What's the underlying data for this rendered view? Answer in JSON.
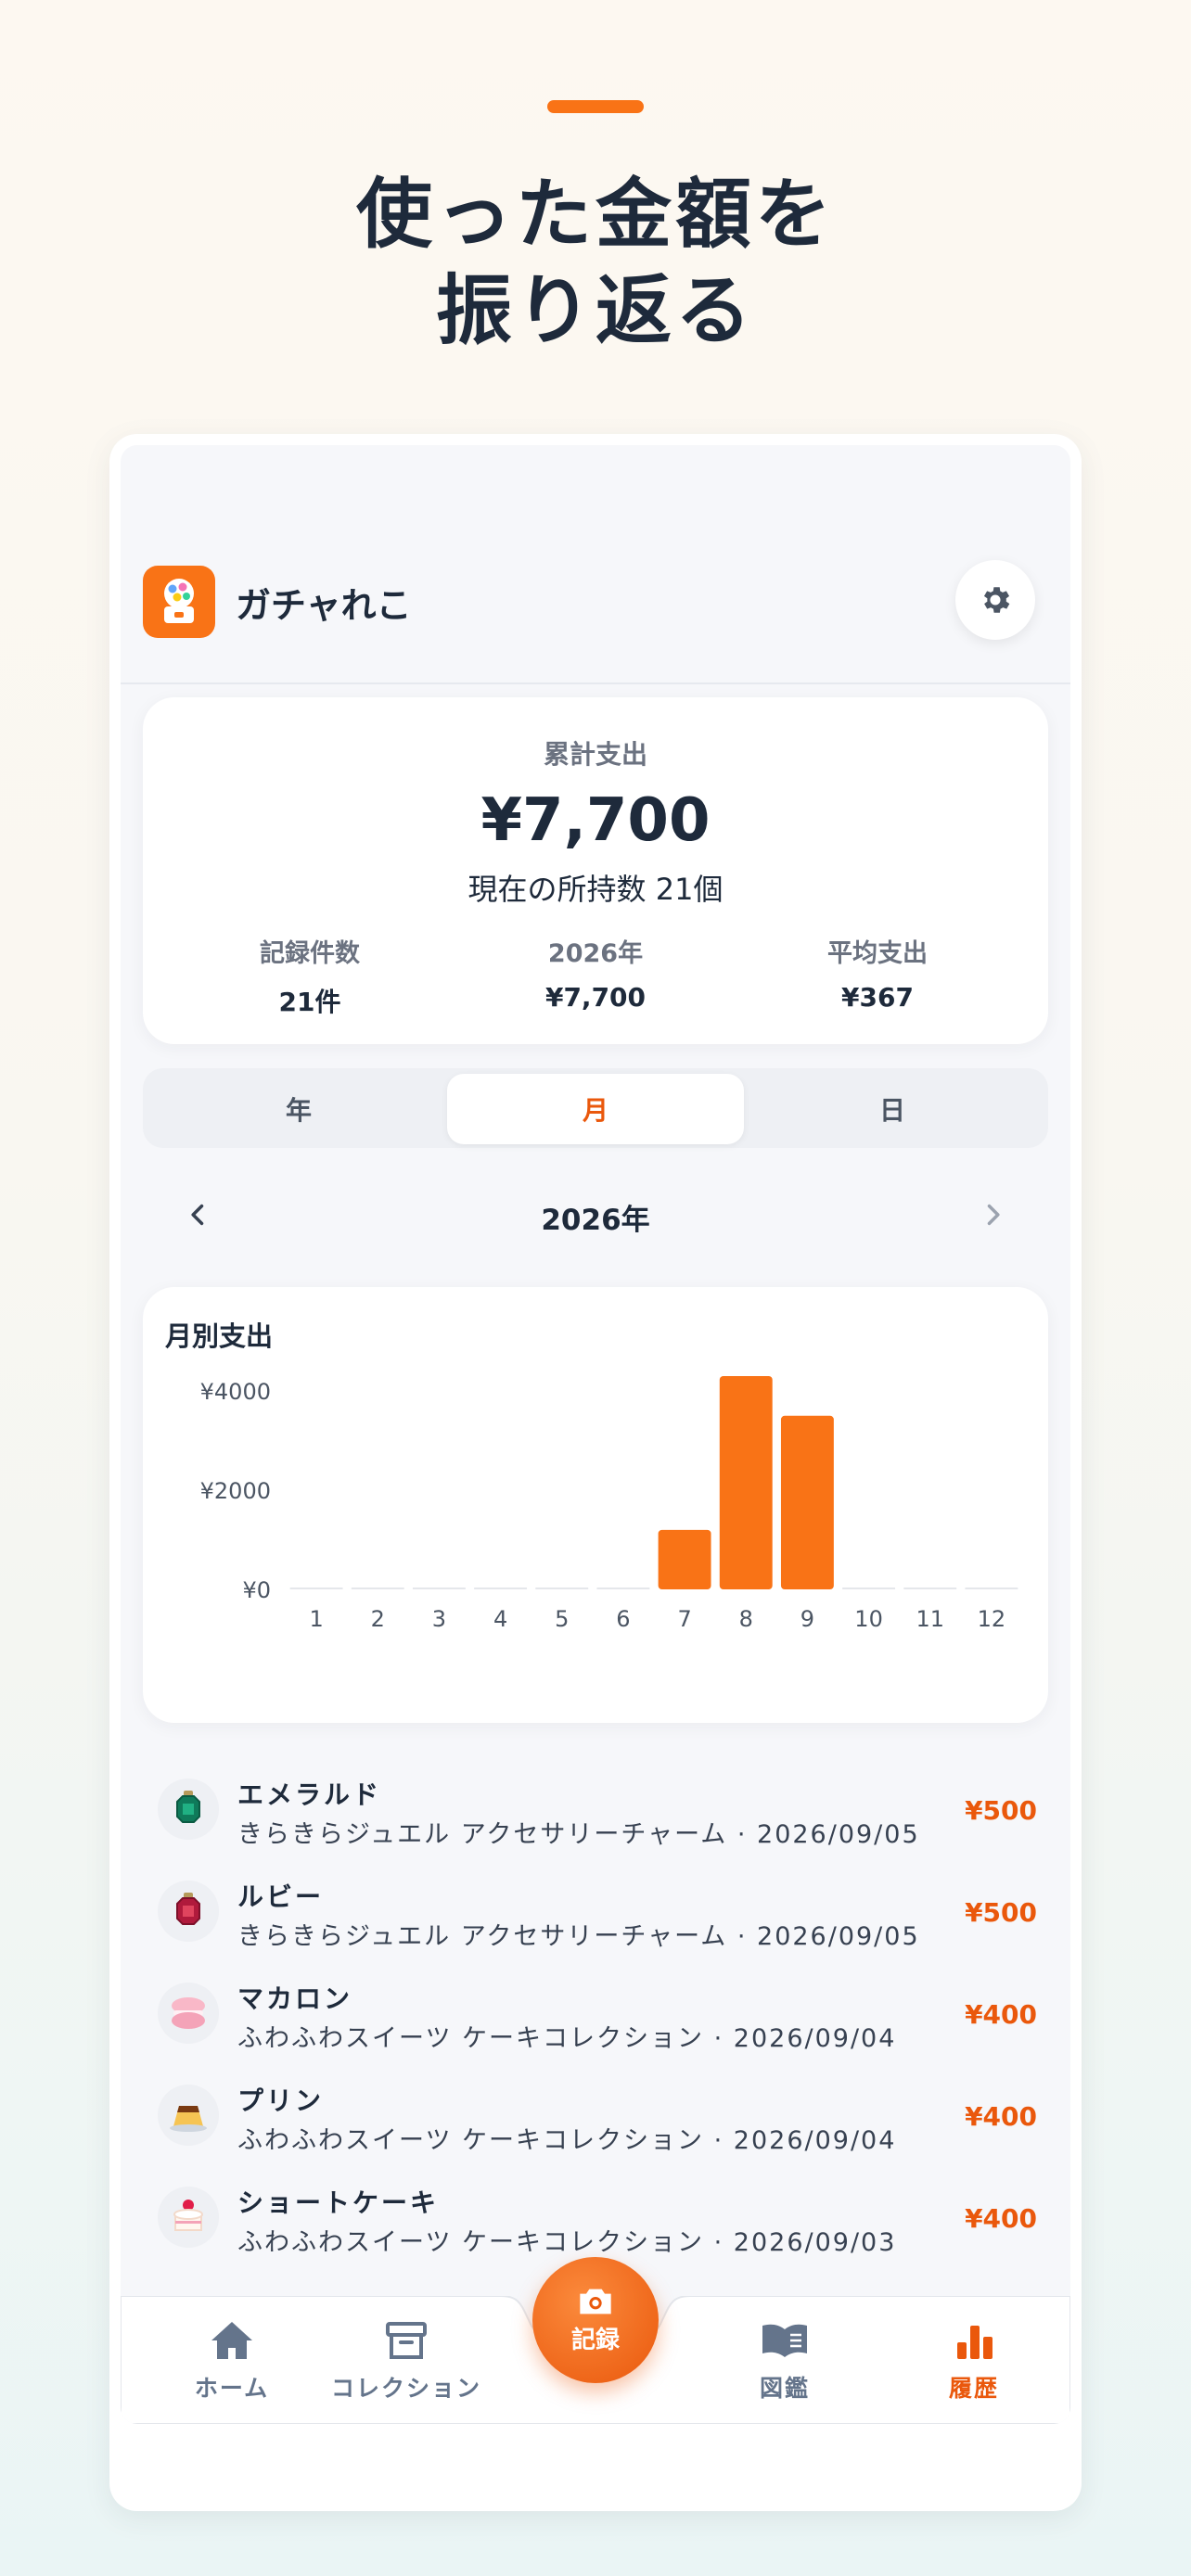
{
  "headline": {
    "line1": "使った金額を",
    "line2": "振り返る"
  },
  "app": {
    "name": "ガチャれこ"
  },
  "summary": {
    "label": "累計支出",
    "total": "¥7,700",
    "owned": "現在の所持数 21個",
    "stats": [
      {
        "key": "記録件数",
        "value": "21件"
      },
      {
        "key": "2026年",
        "value": "¥7,700"
      },
      {
        "key": "平均支出",
        "value": "¥367"
      }
    ]
  },
  "segments": {
    "year": "年",
    "month": "月",
    "day": "日",
    "active": "month"
  },
  "year_nav": {
    "label": "2026年"
  },
  "chart": {
    "title": "月別支出"
  },
  "chart_data": {
    "type": "bar",
    "title": "月別支出",
    "categories": [
      "1",
      "2",
      "3",
      "4",
      "5",
      "6",
      "7",
      "8",
      "9",
      "10",
      "11",
      "12"
    ],
    "values": [
      0,
      0,
      0,
      0,
      0,
      0,
      1200,
      4300,
      3500,
      0,
      0,
      0
    ],
    "yticks": [
      "¥0",
      "¥2000",
      "¥4000"
    ],
    "ytick_values": [
      0,
      2000,
      4000
    ],
    "ylim": [
      0,
      4300
    ],
    "bar_color": "#f97316"
  },
  "list": [
    {
      "name": "エメラルド",
      "sub": "きらきらジュエル アクセサリーチャーム · 2026/09/05",
      "price": "¥500",
      "icon": "emerald-gem-icon"
    },
    {
      "name": "ルビー",
      "sub": "きらきらジュエル アクセサリーチャーム · 2026/09/05",
      "price": "¥500",
      "icon": "ruby-gem-icon"
    },
    {
      "name": "マカロン",
      "sub": "ふわふわスイーツ ケーキコレクション · 2026/09/04",
      "price": "¥400",
      "icon": "macaron-icon"
    },
    {
      "name": "プリン",
      "sub": "ふわふわスイーツ ケーキコレクション · 2026/09/04",
      "price": "¥400",
      "icon": "pudding-icon"
    },
    {
      "name": "ショートケーキ",
      "sub": "ふわふわスイーツ ケーキコレクション · 2026/09/03",
      "price": "¥400",
      "icon": "shortcake-icon"
    }
  ],
  "tabs": {
    "home": "ホーム",
    "collection": "コレクション",
    "record": "記録",
    "encyclopedia": "図鑑",
    "history": "履歴",
    "active": "history"
  },
  "colors": {
    "accent": "#f97316",
    "accent_dark": "#ea580c",
    "text": "#1e2a3b"
  }
}
